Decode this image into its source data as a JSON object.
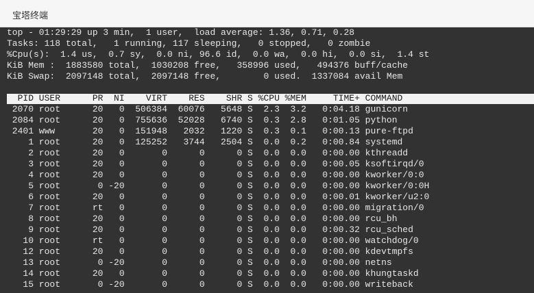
{
  "window": {
    "title": "宝塔终端"
  },
  "summary": [
    "top - 01:29:29 up 3 min,  1 user,  load average: 1.36, 0.71, 0.28",
    "Tasks: 118 total,   1 running, 117 sleeping,   0 stopped,   0 zombie",
    "%Cpu(s):  1.4 us,  0.7 sy,  0.0 ni, 96.6 id,  0.0 wa,  0.0 hi,  0.0 si,  1.4 st",
    "KiB Mem :  1883580 total,  1030208 free,   358996 used,   494376 buff/cache",
    "KiB Swap:  2097148 total,  2097148 free,        0 used.  1337084 avail Mem"
  ],
  "process_table": {
    "header": "  PID USER      PR  NI    VIRT    RES    SHR S %CPU %MEM     TIME+ COMMAND",
    "rows": [
      " 2070 root      20   0  506384  60076   5648 S  2.3  3.2   0:04.18 gunicorn",
      " 2084 root      20   0  755636  52028   6740 S  0.3  2.8   0:01.05 python",
      " 2401 www       20   0  151948   2032   1220 S  0.3  0.1   0:00.13 pure-ftpd",
      "    1 root      20   0  125252   3744   2504 S  0.0  0.2   0:00.84 systemd",
      "    2 root      20   0       0      0      0 S  0.0  0.0   0:00.00 kthreadd",
      "    3 root      20   0       0      0      0 S  0.0  0.0   0:00.05 ksoftirqd/0",
      "    4 root      20   0       0      0      0 S  0.0  0.0   0:00.00 kworker/0:0",
      "    5 root       0 -20       0      0      0 S  0.0  0.0   0:00.00 kworker/0:0H",
      "    6 root      20   0       0      0      0 S  0.0  0.0   0:00.01 kworker/u2:0",
      "    7 root      rt   0       0      0      0 S  0.0  0.0   0:00.00 migration/0",
      "    8 root      20   0       0      0      0 S  0.0  0.0   0:00.00 rcu_bh",
      "    9 root      20   0       0      0      0 S  0.0  0.0   0:00.32 rcu_sched",
      "   10 root      rt   0       0      0      0 S  0.0  0.0   0:00.00 watchdog/0",
      "   12 root      20   0       0      0      0 S  0.0  0.0   0:00.00 kdevtmpfs",
      "   13 root       0 -20       0      0      0 S  0.0  0.0   0:00.00 netns",
      "   14 root      20   0       0      0      0 S  0.0  0.0   0:00.00 khungtaskd",
      "   15 root       0 -20       0      0      0 S  0.0  0.0   0:00.00 writeback"
    ]
  }
}
